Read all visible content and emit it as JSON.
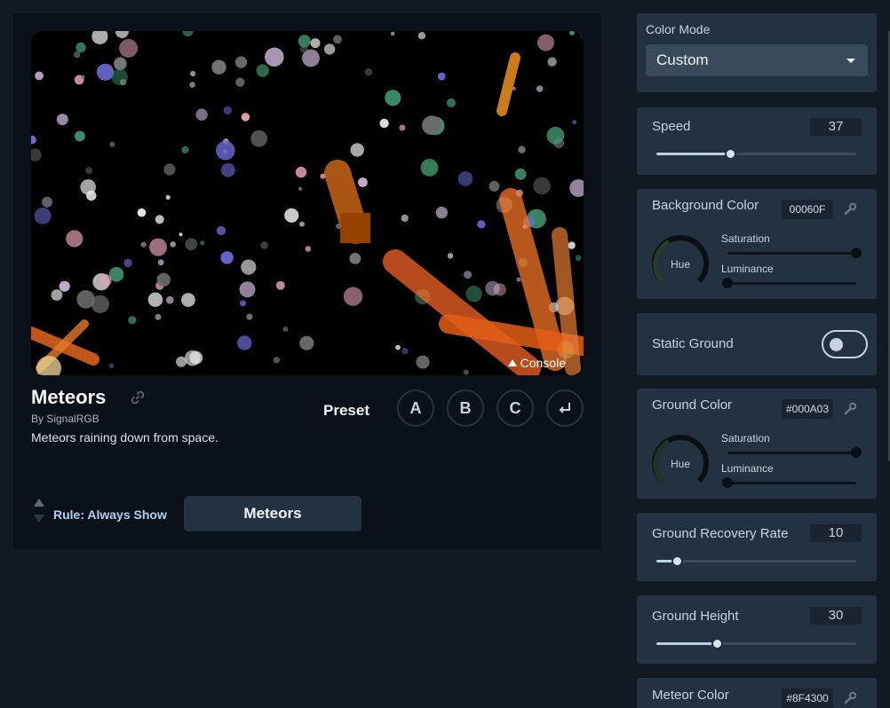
{
  "effect": {
    "title": "Meteors",
    "author": "By SignalRGB",
    "description": "Meteors raining down from space.",
    "console_label": "Console"
  },
  "preset": {
    "label": "Preset",
    "buttons": [
      "A",
      "B",
      "C"
    ],
    "apply_icon": "return-arrow-icon"
  },
  "rule": {
    "text": "Rule: Always Show",
    "button_label": "Meteors"
  },
  "sidebar": {
    "color_mode": {
      "label": "Color Mode",
      "value": "Custom"
    },
    "speed": {
      "label": "Speed",
      "value": "37",
      "fraction": 0.37
    },
    "background_color": {
      "label": "Background Color",
      "hex": "00060F",
      "hue_label": "Hue",
      "saturation_label": "Saturation",
      "luminance_label": "Luminance",
      "saturation": 1.0,
      "luminance": 0.0
    },
    "static_ground": {
      "label": "Static Ground",
      "on": false
    },
    "ground_color": {
      "label": "Ground Color",
      "hex": "#000A03",
      "hue_label": "Hue",
      "saturation_label": "Saturation",
      "luminance_label": "Luminance",
      "saturation": 1.0,
      "luminance": 0.0
    },
    "ground_recovery_rate": {
      "label": "Ground Recovery Rate",
      "value": "10",
      "fraction": 0.1
    },
    "ground_height": {
      "label": "Ground Height",
      "value": "30",
      "fraction": 0.3
    },
    "meteor_color": {
      "label": "Meteor Color",
      "hex": "#8F4300"
    }
  },
  "colors": {
    "accent": "#bcd3e6",
    "panel": "#243140",
    "background": "#111923",
    "meteor_orange": "#ff6a1a"
  }
}
